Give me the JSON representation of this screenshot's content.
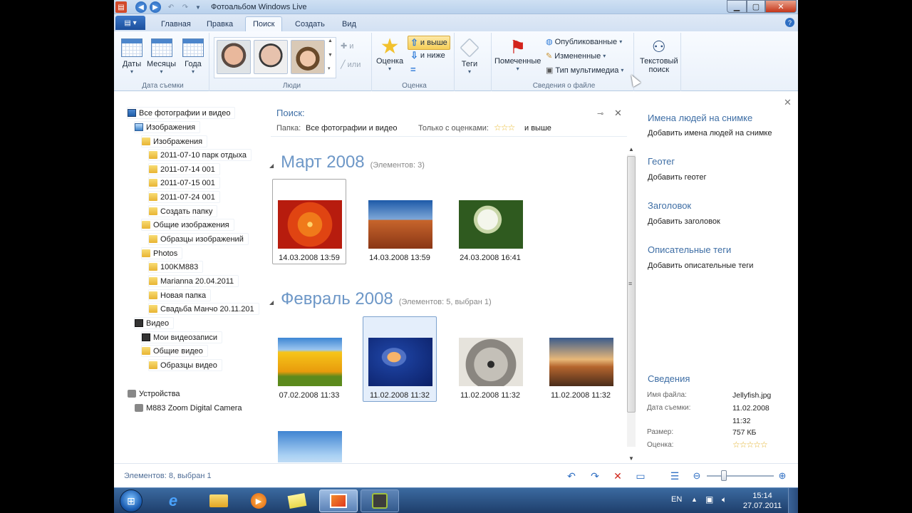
{
  "window": {
    "title": "Фотоальбом Windows Live"
  },
  "ribbon_tabs": [
    "Главная",
    "Правка",
    "Поиск",
    "Создать",
    "Вид"
  ],
  "ribbon": {
    "groups": {
      "date": {
        "label": "Дата съемки",
        "buttons": [
          "Даты",
          "Месяцы",
          "Года"
        ]
      },
      "people": {
        "label": "Люди",
        "add": "и",
        "or": "или"
      },
      "rating": {
        "label": "Оценка",
        "button": "Оценка",
        "above": "и выше",
        "below": "и ниже"
      },
      "tags": {
        "button": "Теги"
      },
      "fileinfo": {
        "label": "Сведения о файле",
        "flagged": "Помеченные",
        "published": "Опубликованные",
        "changed": "Измененные",
        "media_type": "Тип мультимедиа"
      },
      "textsearch": {
        "line1": "Текстовый",
        "line2": "поиск"
      }
    }
  },
  "nav": {
    "items": [
      "Все фотографии и видео",
      "Изображения",
      "Изображения",
      "2011-07-10 парк отдыха",
      "2011-07-14 001",
      "2011-07-15 001",
      "2011-07-24 001",
      "Создать папку",
      "Общие изображения",
      "Образцы изображений",
      "Photos",
      "100KM883",
      "Marianna 20.04.2011",
      "Новая папка",
      "Свадьба Манчо 20.11.201",
      "Видео",
      "Мои видеозаписи",
      "Общие видео",
      "Образцы видео",
      "Устройства",
      "M883 Zoom Digital Camera"
    ]
  },
  "search": {
    "title": "Поиск:",
    "folder_label": "Папка:",
    "folder_value": "Все фотографии и видео",
    "rating_label": "Только с оценками:",
    "rating_stars": "☆☆☆",
    "rating_suffix": "и выше"
  },
  "gallery": {
    "groups": [
      {
        "title": "Март 2008",
        "count": "(Элементов: 3)",
        "items": [
          {
            "date": "14.03.2008 13:59",
            "icon": "flower-photo"
          },
          {
            "date": "14.03.2008 13:59",
            "icon": "desert-photo"
          },
          {
            "date": "24.03.2008 16:41",
            "icon": "hydrangea-photo"
          }
        ]
      },
      {
        "title": "Февраль 2008",
        "count": "(Элементов: 5, выбран 1)",
        "items": [
          {
            "date": "07.02.2008 11:33",
            "icon": "tulips-photo"
          },
          {
            "date": "11.02.2008 11:32",
            "icon": "jellyfish-photo"
          },
          {
            "date": "11.02.2008 11:32",
            "icon": "koala-photo"
          },
          {
            "date": "11.02.2008 11:32",
            "icon": "lighthouse-photo"
          },
          {
            "date": "",
            "icon": "penguins-photo"
          }
        ]
      }
    ]
  },
  "info": {
    "people_head": "Имена людей на снимке",
    "people_add": "Добавить имена людей на снимке",
    "geotag_head": "Геотег",
    "geotag_add": "Добавить геотег",
    "caption_head": "Заголовок",
    "caption_add": "Добавить заголовок",
    "tags_head": "Описательные теги",
    "tags_add": "Добавить описательные теги",
    "details_head": "Сведения",
    "props": {
      "filename_k": "Имя файла:",
      "filename_v": "Jellyfish.jpg",
      "date_k": "Дата съемки:",
      "date_v1": "11.02.2008",
      "date_v2": "11:32",
      "size_k": "Размер:",
      "size_v": "757 КБ",
      "rating_k": "Оценка:",
      "rating_v": "☆☆☆☆☆"
    }
  },
  "status": {
    "text": "Элементов: 8, выбран 1"
  },
  "taskbar": {
    "lang": "EN",
    "time": "15:14",
    "date": "27.07.2011"
  }
}
